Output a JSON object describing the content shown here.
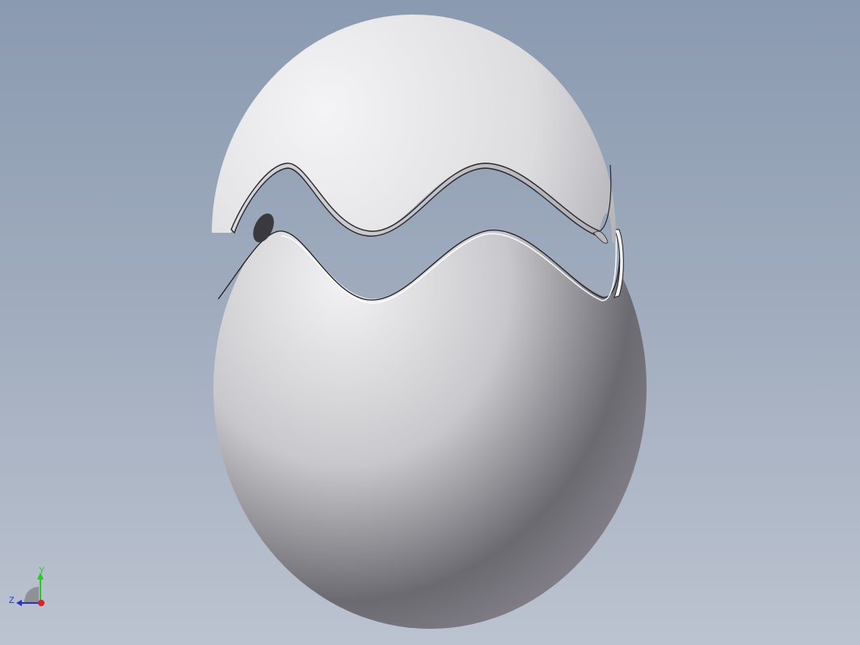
{
  "viewport": {
    "model": "egg-shell-cracked-two-halves",
    "background_colors": [
      "#8a9ab0",
      "#bcc3d0"
    ],
    "shell_color": "#e8e8ec"
  },
  "triad": {
    "y_label": "Y",
    "z_label": "Z",
    "y_color": "#22cc22",
    "z_color": "#2233dd",
    "x_color": "#dd2222"
  }
}
